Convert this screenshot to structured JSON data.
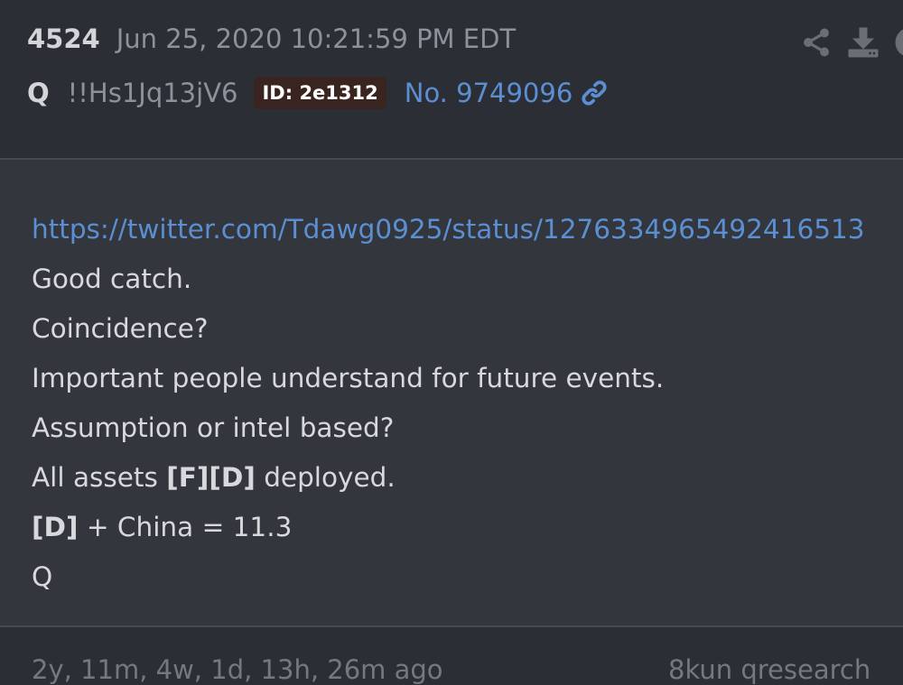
{
  "post": {
    "number": "4524",
    "date": "Jun 25, 2020 10:21:59 PM EDT",
    "author": "Q",
    "tripcode": "!!Hs1Jq13jV6",
    "id_badge": "ID: 2e1312",
    "post_link": "No. 9749096"
  },
  "header_icons": [
    "share-icon",
    "download-icon",
    "info-icon"
  ],
  "content": {
    "link": "https://twitter.com/Tdawg0925/status/1276334965492416513",
    "line2": "Good catch.",
    "line3": "Coincidence?",
    "line4": "Important people understand for future events.",
    "line5": "Assumption or intel based?",
    "line6_prefix": "All assets ",
    "line6_bold": "[F][D]",
    "line6_suffix": " deployed.",
    "line7_bold": "[D]",
    "line7_suffix": " + China = 11.3",
    "line8": "Q"
  },
  "footer": {
    "time_ago": "2y, 11m, 4w, 1d, 13h, 26m ago",
    "source": "8kun qresearch"
  },
  "colors": {
    "background": "#2b2e35",
    "content_background": "#33363d",
    "link": "#5b8fd1",
    "badge": "#3a2420"
  }
}
